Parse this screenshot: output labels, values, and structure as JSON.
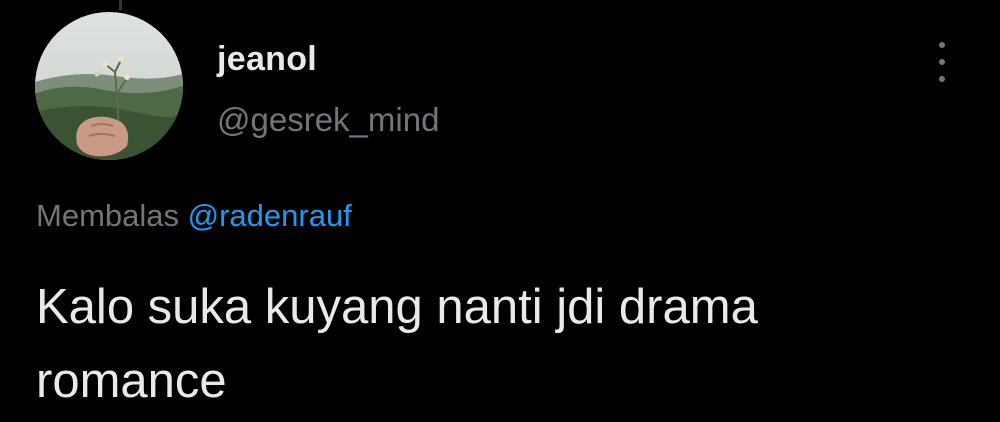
{
  "tweet": {
    "author": {
      "display_name": "jeanol",
      "handle": "@gesrek_mind"
    },
    "menu_icon": "more-vertical-icon",
    "reply_prefix": "Membalas",
    "reply_to": "@radenrauf",
    "text_line1": "Kalo suka kuyang nanti jdi drama",
    "text_line2": "romance"
  },
  "colors": {
    "background": "#000000",
    "text": "#e7e9ea",
    "muted": "#71767b",
    "accent": "#1d9bf0"
  }
}
